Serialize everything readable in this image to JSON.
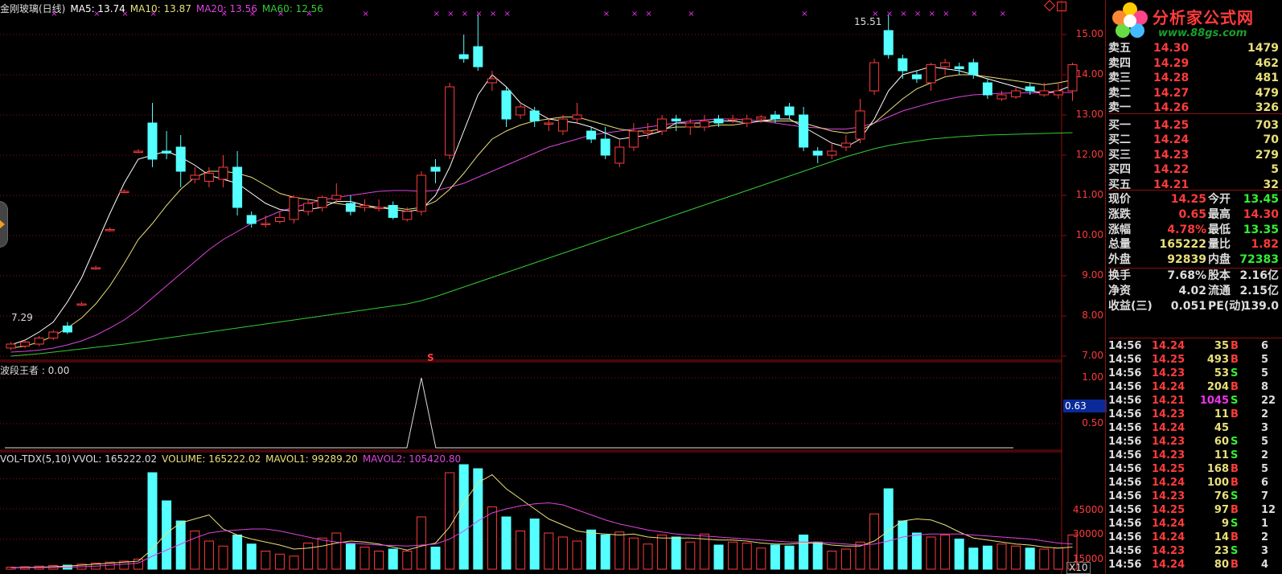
{
  "header": {
    "title": "金刚玻璃(日线)",
    "ma5": "MA5: 13.74",
    "ma10": "MA10: 13.87",
    "ma20": "MA20: 13.56",
    "ma60": "MA60: 12.56"
  },
  "indicator": {
    "name": "波段王者 : 0.00",
    "current_value": "0.63",
    "axis": [
      "1.00",
      "0.50"
    ]
  },
  "volume": {
    "name": "VOL-TDX(5,10)",
    "vvol": "VVOL: 165222.02",
    "volume": "VOLUME: 165222.02",
    "mavol1": "MAVOL1: 99289.20",
    "mavol2": "MAVOL2: 105420.80",
    "axis": [
      "45000",
      "30000",
      "15000"
    ],
    "unit": "X10"
  },
  "price_axis": [
    "15.00",
    "14.00",
    "13.00",
    "12.00",
    "11.00",
    "10.00",
    "9.00",
    "8.00",
    "7.00"
  ],
  "chart_annotations": {
    "high": "15.51",
    "low": "7.29",
    "signal_marker": "S"
  },
  "logo": {
    "text": "分析家公式网",
    "url": "www.88gs.com"
  },
  "colors": {
    "up": "#ff3b3b",
    "down": "#55ffff",
    "ma5": "#ffffff",
    "ma10": "#e8e07a",
    "ma20": "#dd44dd",
    "ma60": "#33cc33",
    "grid": "#8a1010"
  },
  "order_book": [
    {
      "label": "卖五",
      "price": "14.30",
      "vol": "1479"
    },
    {
      "label": "卖四",
      "price": "14.29",
      "vol": "462"
    },
    {
      "label": "卖三",
      "price": "14.28",
      "vol": "481"
    },
    {
      "label": "卖二",
      "price": "14.27",
      "vol": "479"
    },
    {
      "label": "卖一",
      "price": "14.26",
      "vol": "326"
    },
    {
      "label": "买一",
      "price": "14.25",
      "vol": "703"
    },
    {
      "label": "买二",
      "price": "14.24",
      "vol": "70"
    },
    {
      "label": "买三",
      "price": "14.23",
      "vol": "279"
    },
    {
      "label": "买四",
      "price": "14.22",
      "vol": "5"
    },
    {
      "label": "买五",
      "price": "14.21",
      "vol": "32"
    }
  ],
  "quote": [
    {
      "l1": "现价",
      "v1": "14.25",
      "l2": "今开",
      "v2": "13.45"
    },
    {
      "l1": "涨跌",
      "v1": "0.65",
      "l2": "最高",
      "v2": "14.30"
    },
    {
      "l1": "涨幅",
      "v1": "4.78%",
      "l2": "最低",
      "v2": "13.35"
    },
    {
      "l1": "总量",
      "v1": "165222",
      "l2": "量比",
      "v2": "1.82"
    },
    {
      "l1": "外盘",
      "v1": "92839",
      "l2": "内盘",
      "v2": "72383"
    }
  ],
  "fundamentals": [
    {
      "l1": "换手",
      "v1": "7.68%",
      "l2": "股本",
      "v2": "2.16亿"
    },
    {
      "l1": "净资",
      "v1": "4.02",
      "l2": "流通",
      "v2": "2.15亿"
    },
    {
      "l1": "收益(三)",
      "v1": "0.051",
      "l2": "PE(动)",
      "v2": "139.0"
    }
  ],
  "ticks": [
    {
      "time": "14:56",
      "price": "14.24",
      "vol": "35",
      "side": "B",
      "n": "6"
    },
    {
      "time": "14:56",
      "price": "14.25",
      "vol": "493",
      "side": "B",
      "n": "5"
    },
    {
      "time": "14:56",
      "price": "14.23",
      "vol": "53",
      "side": "S",
      "n": "5"
    },
    {
      "time": "14:56",
      "price": "14.24",
      "vol": "204",
      "side": "B",
      "n": "8"
    },
    {
      "time": "14:56",
      "price": "14.21",
      "vol": "1045",
      "side": "S",
      "n": "22"
    },
    {
      "time": "14:56",
      "price": "14.23",
      "vol": "11",
      "side": "B",
      "n": "2"
    },
    {
      "time": "14:56",
      "price": "14.24",
      "vol": "45",
      "side": "",
      "n": "3"
    },
    {
      "time": "14:56",
      "price": "14.23",
      "vol": "60",
      "side": "S",
      "n": "5"
    },
    {
      "time": "14:56",
      "price": "14.23",
      "vol": "11",
      "side": "S",
      "n": "2"
    },
    {
      "time": "14:56",
      "price": "14.25",
      "vol": "168",
      "side": "B",
      "n": "5"
    },
    {
      "time": "14:56",
      "price": "14.24",
      "vol": "100",
      "side": "B",
      "n": "6"
    },
    {
      "time": "14:56",
      "price": "14.23",
      "vol": "76",
      "side": "S",
      "n": "7"
    },
    {
      "time": "14:56",
      "price": "14.25",
      "vol": "97",
      "side": "B",
      "n": "12"
    },
    {
      "time": "14:56",
      "price": "14.24",
      "vol": "9",
      "side": "S",
      "n": "1"
    },
    {
      "time": "14:56",
      "price": "14.24",
      "vol": "14",
      "side": "B",
      "n": "2"
    },
    {
      "time": "14:56",
      "price": "14.23",
      "vol": "23",
      "side": "S",
      "n": "3"
    },
    {
      "time": "14:56",
      "price": "14.24",
      "vol": "80",
      "side": "B",
      "n": "4"
    }
  ],
  "chart_data": {
    "type": "candlestick",
    "price_ylim": [
      6.9,
      15.5
    ],
    "candles": [
      [
        7.2,
        7.3,
        7.35,
        7.15
      ],
      [
        7.25,
        7.35,
        7.4,
        7.2
      ],
      [
        7.3,
        7.45,
        7.5,
        7.25
      ],
      [
        7.45,
        7.6,
        7.65,
        7.4
      ],
      [
        7.75,
        7.6,
        7.85,
        7.55
      ],
      [
        8.3,
        8.3,
        8.35,
        8.25
      ],
      [
        9.2,
        9.2,
        9.25,
        9.15
      ],
      [
        10.15,
        10.15,
        10.2,
        10.1
      ],
      [
        11.1,
        11.1,
        11.15,
        11.05
      ],
      [
        12.1,
        12.1,
        12.15,
        12.05
      ],
      [
        12.8,
        11.9,
        13.3,
        11.7
      ],
      [
        12.1,
        12.05,
        12.6,
        11.9
      ],
      [
        12.2,
        11.6,
        12.5,
        11.2
      ],
      [
        11.4,
        11.5,
        11.7,
        11.3
      ],
      [
        11.35,
        11.55,
        11.7,
        11.2
      ],
      [
        11.4,
        11.7,
        12.0,
        11.2
      ],
      [
        11.7,
        10.7,
        12.1,
        10.5
      ],
      [
        10.5,
        10.3,
        10.6,
        10.2
      ],
      [
        10.3,
        10.3,
        10.5,
        10.2
      ],
      [
        10.35,
        10.45,
        10.6,
        10.3
      ],
      [
        10.4,
        10.95,
        11.0,
        10.3
      ],
      [
        10.6,
        10.8,
        10.9,
        10.5
      ],
      [
        10.7,
        10.95,
        11.0,
        10.6
      ],
      [
        10.9,
        11.0,
        11.3,
        10.8
      ],
      [
        10.8,
        10.6,
        11.0,
        10.5
      ],
      [
        10.7,
        10.75,
        10.9,
        10.6
      ],
      [
        10.7,
        10.7,
        10.9,
        10.6
      ],
      [
        10.75,
        10.45,
        10.85,
        10.4
      ],
      [
        10.4,
        10.6,
        10.7,
        10.35
      ],
      [
        10.6,
        11.5,
        11.6,
        10.5
      ],
      [
        11.7,
        11.6,
        11.9,
        11.3
      ],
      [
        12.0,
        13.7,
        13.8,
        11.9
      ],
      [
        14.5,
        14.4,
        15.0,
        14.3
      ],
      [
        14.7,
        14.2,
        15.5,
        14.1
      ],
      [
        13.8,
        13.9,
        14.1,
        13.6
      ],
      [
        13.6,
        12.9,
        13.7,
        12.7
      ],
      [
        13.0,
        13.2,
        13.3,
        12.9
      ],
      [
        13.1,
        12.85,
        13.2,
        12.7
      ],
      [
        12.8,
        12.8,
        12.9,
        12.6
      ],
      [
        12.6,
        12.9,
        13.0,
        12.5
      ],
      [
        12.9,
        13.0,
        13.3,
        12.8
      ],
      [
        12.6,
        12.4,
        12.7,
        12.3
      ],
      [
        12.4,
        12.0,
        12.7,
        11.9
      ],
      [
        11.8,
        12.2,
        12.4,
        11.7
      ],
      [
        12.2,
        12.6,
        12.8,
        12.1
      ],
      [
        12.55,
        12.6,
        12.8,
        12.4
      ],
      [
        12.6,
        12.9,
        13.0,
        12.5
      ],
      [
        12.9,
        12.85,
        13.0,
        12.6
      ],
      [
        12.7,
        12.8,
        12.9,
        12.5
      ],
      [
        12.7,
        12.85,
        13.0,
        12.6
      ],
      [
        12.9,
        12.8,
        13.0,
        12.7
      ],
      [
        12.9,
        12.9,
        13.0,
        12.8
      ],
      [
        12.8,
        12.9,
        13.0,
        12.7
      ],
      [
        12.9,
        12.95,
        13.0,
        12.8
      ],
      [
        13.0,
        12.9,
        13.1,
        12.8
      ],
      [
        13.2,
        13.0,
        13.3,
        12.9
      ],
      [
        13.0,
        12.2,
        13.2,
        12.1
      ],
      [
        12.1,
        12.0,
        12.2,
        11.8
      ],
      [
        12.0,
        12.1,
        12.3,
        11.9
      ],
      [
        12.2,
        12.3,
        12.5,
        12.1
      ],
      [
        12.4,
        13.1,
        13.4,
        12.3
      ],
      [
        13.6,
        14.3,
        14.4,
        13.5
      ],
      [
        15.1,
        14.5,
        15.5,
        14.4
      ],
      [
        14.4,
        14.1,
        14.5,
        13.9
      ],
      [
        14.0,
        13.9,
        14.1,
        13.8
      ],
      [
        13.8,
        14.25,
        14.3,
        13.6
      ],
      [
        14.2,
        14.3,
        14.4,
        14.0
      ],
      [
        14.2,
        14.15,
        14.3,
        14.0
      ],
      [
        14.3,
        14.0,
        14.4,
        13.9
      ],
      [
        13.8,
        13.5,
        13.9,
        13.4
      ],
      [
        13.4,
        13.5,
        13.6,
        13.35
      ],
      [
        13.45,
        13.6,
        13.7,
        13.4
      ],
      [
        13.7,
        13.6,
        13.8,
        13.5
      ],
      [
        13.5,
        13.6,
        13.8,
        13.45
      ],
      [
        13.5,
        13.6,
        13.8,
        13.4
      ],
      [
        13.6,
        14.25,
        14.3,
        13.35
      ]
    ],
    "ma5": [
      7.28,
      7.4,
      7.6,
      7.85,
      8.35,
      8.95,
      9.75,
      10.55,
      11.3,
      11.9,
      12.0,
      12.1,
      11.95,
      11.75,
      11.5,
      11.4,
      11.3,
      11.05,
      10.8,
      10.65,
      10.6,
      10.65,
      10.7,
      10.85,
      10.85,
      10.75,
      10.7,
      10.65,
      10.6,
      10.65,
      11.0,
      11.7,
      12.6,
      13.5,
      14.0,
      13.7,
      13.3,
      13.1,
      12.9,
      12.85,
      12.8,
      12.7,
      12.55,
      12.4,
      12.45,
      12.5,
      12.6,
      12.8,
      12.8,
      12.8,
      12.85,
      12.85,
      12.8,
      12.85,
      12.9,
      12.9,
      12.7,
      12.5,
      12.3,
      12.2,
      12.4,
      12.9,
      13.6,
      14.0,
      14.1,
      14.2,
      14.15,
      14.1,
      14.0,
      13.9,
      13.8,
      13.7,
      13.6,
      13.55,
      13.6,
      13.74
    ],
    "ma10": [
      7.2,
      7.25,
      7.35,
      7.5,
      7.7,
      7.95,
      8.3,
      8.75,
      9.3,
      9.9,
      10.3,
      10.75,
      11.15,
      11.45,
      11.6,
      11.6,
      11.55,
      11.45,
      11.25,
      11.05,
      10.95,
      10.9,
      10.85,
      10.8,
      10.75,
      10.7,
      10.7,
      10.7,
      10.65,
      10.7,
      10.85,
      11.15,
      11.55,
      12.0,
      12.4,
      12.6,
      12.75,
      12.85,
      12.9,
      12.95,
      12.95,
      12.85,
      12.75,
      12.65,
      12.6,
      12.6,
      12.65,
      12.7,
      12.7,
      12.7,
      12.75,
      12.75,
      12.8,
      12.85,
      12.85,
      12.85,
      12.8,
      12.7,
      12.6,
      12.55,
      12.6,
      12.8,
      13.1,
      13.4,
      13.65,
      13.8,
      13.95,
      14.0,
      14.0,
      13.95,
      13.9,
      13.85,
      13.8,
      13.75,
      13.8,
      13.87
    ],
    "ma20": [
      7.1,
      7.12,
      7.15,
      7.2,
      7.28,
      7.38,
      7.52,
      7.7,
      7.9,
      8.15,
      8.45,
      8.75,
      9.05,
      9.35,
      9.65,
      9.9,
      10.1,
      10.3,
      10.45,
      10.6,
      10.7,
      10.8,
      10.88,
      10.95,
      11.0,
      11.05,
      11.1,
      11.12,
      11.12,
      11.1,
      11.12,
      11.2,
      11.3,
      11.45,
      11.6,
      11.75,
      11.9,
      12.05,
      12.2,
      12.3,
      12.4,
      12.5,
      12.55,
      12.6,
      12.65,
      12.7,
      12.75,
      12.8,
      12.85,
      12.88,
      12.9,
      12.9,
      12.88,
      12.85,
      12.8,
      12.75,
      12.7,
      12.68,
      12.65,
      12.65,
      12.7,
      12.8,
      12.95,
      13.1,
      13.2,
      13.3,
      13.38,
      13.45,
      13.5,
      13.52,
      13.54,
      13.55,
      13.55,
      13.55,
      13.56,
      13.56
    ],
    "ma60": [
      7.0,
      7.03,
      7.06,
      7.1,
      7.14,
      7.18,
      7.22,
      7.26,
      7.3,
      7.35,
      7.4,
      7.45,
      7.5,
      7.55,
      7.6,
      7.65,
      7.7,
      7.75,
      7.8,
      7.85,
      7.9,
      7.95,
      8.0,
      8.05,
      8.1,
      8.15,
      8.2,
      8.25,
      8.3,
      8.38,
      8.48,
      8.6,
      8.72,
      8.84,
      8.96,
      9.08,
      9.2,
      9.32,
      9.44,
      9.56,
      9.68,
      9.8,
      9.92,
      10.04,
      10.16,
      10.28,
      10.4,
      10.52,
      10.64,
      10.76,
      10.88,
      11.0,
      11.12,
      11.24,
      11.36,
      11.48,
      11.6,
      11.72,
      11.84,
      11.96,
      12.06,
      12.16,
      12.24,
      12.3,
      12.35,
      12.4,
      12.43,
      12.46,
      12.48,
      12.5,
      12.51,
      12.52,
      12.53,
      12.54,
      12.55,
      12.56
    ],
    "volume_ylim": [
      0,
      52000
    ],
    "volumes": [
      1000,
      1200,
      1500,
      1800,
      2000,
      2500,
      3000,
      3500,
      4000,
      5000,
      48000,
      34000,
      24000,
      19000,
      14000,
      11500,
      17000,
      12500,
      9000,
      7500,
      6500,
      13000,
      15500,
      18000,
      12500,
      11000,
      9000,
      10000,
      9000,
      26000,
      11000,
      48000,
      52000,
      50000,
      31000,
      26000,
      19000,
      25000,
      18000,
      16000,
      14000,
      19500,
      17000,
      18500,
      15500,
      12500,
      17000,
      16000,
      13500,
      17500,
      12000,
      13500,
      13000,
      10500,
      12000,
      11500,
      17000,
      13500,
      9000,
      10000,
      13500,
      27500,
      40000,
      24000,
      18000,
      16000,
      17000,
      15000,
      10500,
      11500,
      12500,
      11500,
      10500,
      10000,
      10500,
      17000
    ],
    "mavol1": [
      800,
      900,
      1000,
      1200,
      1500,
      2000,
      2500,
      3000,
      3500,
      4000,
      10000,
      18000,
      23000,
      25000,
      27000,
      20000,
      17000,
      15000,
      13500,
      12000,
      10000,
      10500,
      11500,
      13000,
      14000,
      13500,
      12500,
      11000,
      9500,
      11500,
      13000,
      21000,
      33000,
      43000,
      47000,
      40000,
      35000,
      30000,
      25000,
      22000,
      19000,
      18000,
      17500,
      17000,
      17500,
      16000,
      15500,
      15500,
      15500,
      15000,
      14500,
      14500,
      14000,
      13000,
      12500,
      12500,
      13000,
      13000,
      12000,
      11500,
      11500,
      14000,
      19000,
      24000,
      25000,
      24500,
      22000,
      18500,
      15500,
      14500,
      13500,
      12500,
      12000,
      11000,
      10500,
      11000
    ],
    "mavol2": [
      700,
      750,
      800,
      900,
      1000,
      1200,
      1500,
      2000,
      2500,
      3000,
      6500,
      9500,
      12500,
      15500,
      18000,
      19000,
      19500,
      20000,
      20000,
      19000,
      17500,
      16000,
      14500,
      13500,
      13000,
      12500,
      12000,
      11800,
      11500,
      12000,
      12500,
      15000,
      19000,
      24000,
      28000,
      30000,
      31500,
      32500,
      33000,
      32000,
      29500,
      27000,
      24500,
      22500,
      21000,
      19500,
      18500,
      17500,
      17000,
      16500,
      16000,
      15500,
      15000,
      14500,
      14000,
      13500,
      13500,
      13500,
      13000,
      12500,
      12000,
      12500,
      14000,
      16000,
      17000,
      17500,
      17500,
      17500,
      17000,
      16500,
      16000,
      15500,
      15000,
      14000,
      13000,
      12500
    ],
    "indicator_values_pulse_index": 29
  }
}
